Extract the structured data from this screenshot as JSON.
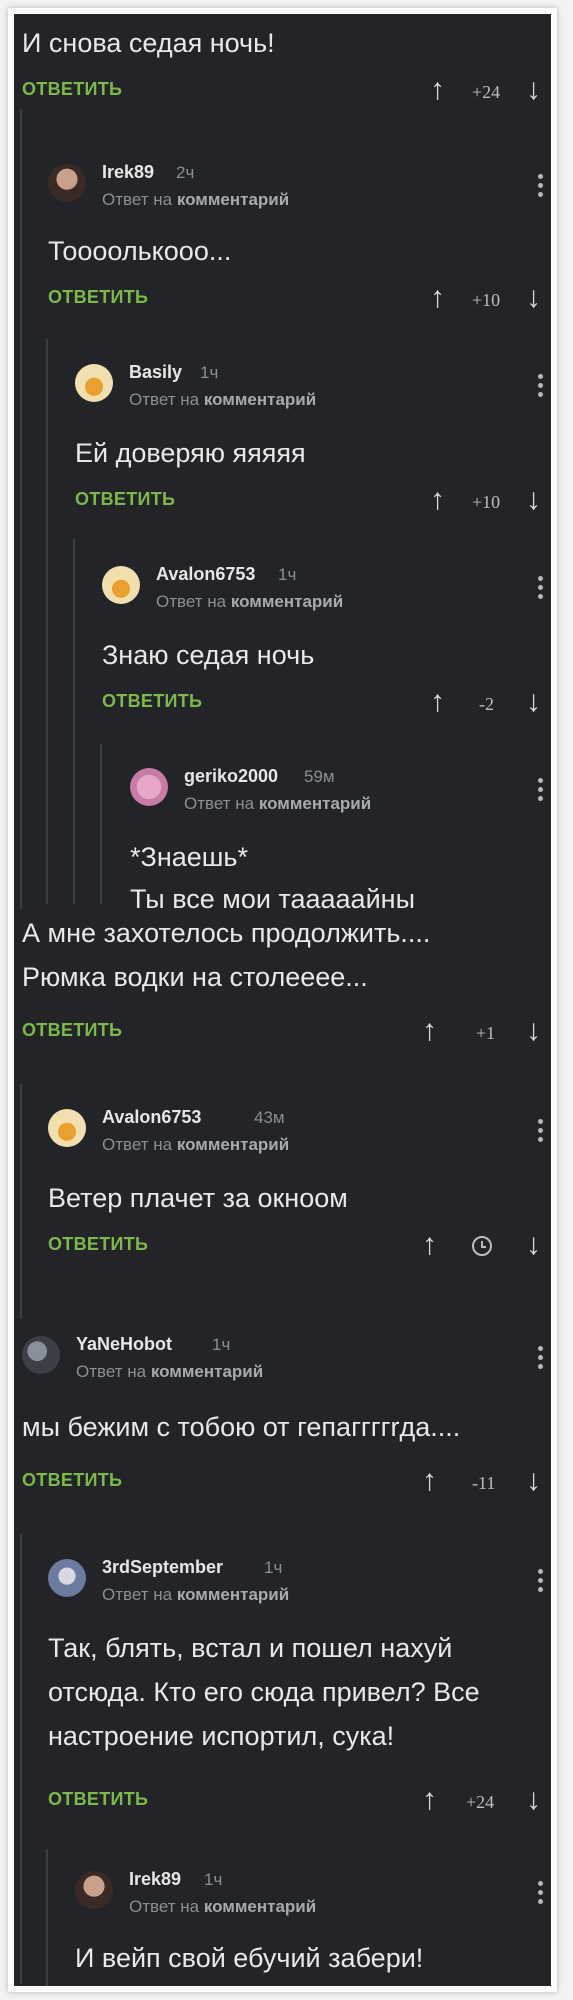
{
  "top": {
    "text": "И снова седая ночь!",
    "reply": "ОТВЕТИТЬ",
    "score": "+24"
  },
  "common": {
    "reply_to_prefix": "Ответ на",
    "reply_to_target": "комментарий",
    "reply_label": "ОТВЕТИТЬ"
  },
  "comments": [
    {
      "user": "Irek89",
      "time": "2ч",
      "lines": [
        "Тоооолькооо..."
      ],
      "score": "+10"
    },
    {
      "user": "Basily",
      "time": "1ч",
      "lines": [
        "Ей доверяю яяяяя"
      ],
      "score": "+10"
    },
    {
      "user": "Avalon6753",
      "time": "1ч",
      "lines": [
        "Знаю седая ночь"
      ],
      "score": "-2"
    },
    {
      "user": "geriko2000",
      "time": "59м",
      "lines": [
        "*Знаешь*",
        "Ты все мои тааааайны"
      ]
    },
    {
      "lines": [
        "А мне захотелось продолжить....",
        "Рюмка водки на столееее..."
      ],
      "score": "+1"
    },
    {
      "user": "Avalon6753",
      "time": "43м",
      "lines": [
        "Ветер плачет за окноом"
      ],
      "score_icon": "clock-icon"
    },
    {
      "user": "YaNeHobot",
      "time": "1ч",
      "lines": [
        "мы бежим с тобою от гепаггггrда...."
      ],
      "score": "-11"
    },
    {
      "user": "3rdSeptember",
      "time": "1ч",
      "lines": [
        "Так, блять, встал и пошел нахуй",
        "отсюда. Кто его сюда привел? Все",
        "настроение испортил, сука!"
      ],
      "score": "+24"
    },
    {
      "user": "Irek89",
      "time": "1ч",
      "lines": [
        "И вейп свой ебучий забери!"
      ]
    }
  ]
}
